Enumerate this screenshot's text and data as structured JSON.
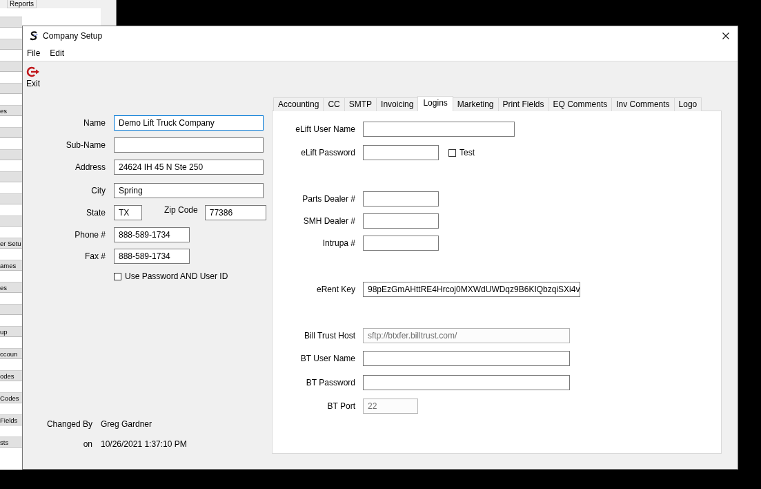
{
  "background_window": {
    "tab": "Reports",
    "rows": [
      {
        "label": ""
      },
      {
        "label": ""
      },
      {
        "label": ""
      },
      {
        "label": ""
      },
      {
        "label": "es"
      },
      {
        "label": ""
      },
      {
        "label": ""
      },
      {
        "label": ""
      },
      {
        "label": ""
      },
      {
        "label": ""
      },
      {
        "label": "er Setu"
      },
      {
        "label": "ames"
      },
      {
        "label": "es"
      },
      {
        "label": ""
      },
      {
        "label": "up"
      },
      {
        "label": "ccoun"
      },
      {
        "label": "odes"
      },
      {
        "label": "Codes"
      },
      {
        "label": "Fields"
      },
      {
        "label": "sts"
      }
    ]
  },
  "window": {
    "title": "Company Setup"
  },
  "menu": [
    "File",
    "Edit"
  ],
  "toolbar": {
    "exit": "Exit"
  },
  "company_fields": [
    {
      "label": "Name",
      "value": "Demo Lift Truck Company",
      "focused": true
    },
    {
      "label": "Sub-Name",
      "focused": false
    },
    {
      "label": "Address",
      "value": "24624 IH 45 N Ste 250",
      "focused": false
    },
    {
      "label": "City",
      "value": "Spring",
      "focused": false
    },
    {
      "label": "State",
      "value": "TX",
      "focused": false
    },
    {
      "label": "Zip Code",
      "value": "77386",
      "focused": false
    },
    {
      "label": "Phone #",
      "value": "888-589-1734",
      "focused": false
    },
    {
      "label": "Fax #",
      "value": "888-589-1734",
      "focused": false
    }
  ],
  "use_password_and_user_id": {
    "label": "Use Password AND User ID",
    "checked": false
  },
  "changed_by": {
    "label": "Changed By",
    "value": "Greg Gardner"
  },
  "changed_on": {
    "label": "on",
    "value": "10/26/2021 1:37:10 PM"
  },
  "tabs": [
    {
      "label": "Accounting",
      "selected": false
    },
    {
      "label": "CC",
      "selected": false
    },
    {
      "label": "SMTP",
      "selected": false
    },
    {
      "label": "Invoicing",
      "selected": false
    },
    {
      "label": "Logins",
      "selected": true
    },
    {
      "label": "Marketing",
      "selected": false
    },
    {
      "label": "Print Fields",
      "selected": false
    },
    {
      "label": "EQ Comments",
      "selected": false
    },
    {
      "label": "Inv Comments",
      "selected": false
    },
    {
      "label": "Logo",
      "selected": false
    }
  ],
  "login_fields": [
    {
      "label": "eLift User Name",
      "disabled": false
    },
    {
      "label": "eLift Password",
      "disabled": false
    },
    {
      "label": "Parts Dealer #",
      "disabled": false
    },
    {
      "label": "SMH Dealer #",
      "disabled": false
    },
    {
      "label": "Intrupa #",
      "disabled": false
    },
    {
      "label": "eRent Key",
      "value": "98pEzGmAHttRE4Hrcoj0MXWdUWDqz9B6KIQbzqiSXi4v",
      "disabled": false
    },
    {
      "label": "Bill Trust Host",
      "value": "sftp://btxfer.billtrust.com/",
      "disabled": true
    },
    {
      "label": "BT User Name",
      "disabled": false
    },
    {
      "label": "BT Password",
      "disabled": false
    },
    {
      "label": "BT Port",
      "value": "22",
      "disabled": true
    }
  ],
  "test_checkbox": {
    "label": "Test",
    "checked": false
  }
}
